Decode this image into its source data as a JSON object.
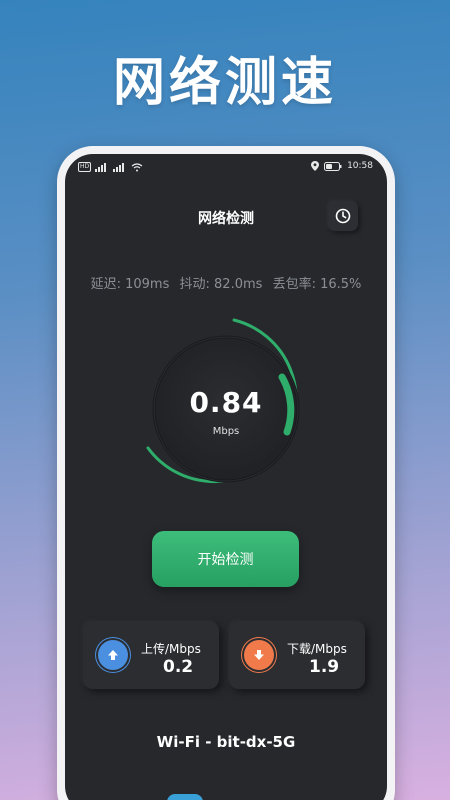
{
  "promo": {
    "title": "网络测速"
  },
  "status_bar": {
    "left_badges": [
      "HD",
      "4G",
      "4G"
    ],
    "time": "10:58",
    "icons": [
      "location-icon",
      "battery-icon",
      "wifi-icon",
      "signal-icon"
    ]
  },
  "header": {
    "title": "网络检测",
    "history_icon": "clock-icon"
  },
  "stats": {
    "latency": "延迟: 109ms",
    "jitter": "抖动: 82.0ms",
    "packet_loss": "丢包率: 16.5%"
  },
  "gauge": {
    "value": "0.84",
    "unit": "Mbps",
    "progress_fraction": 0.05,
    "accent": "#2fae6b"
  },
  "start_button": {
    "label": "开始检测"
  },
  "upload": {
    "label": "上传/Mbps",
    "value": "0.2",
    "icon": "upload-arrow-icon",
    "color": "#4a8fe0"
  },
  "download": {
    "label": "下载/Mbps",
    "value": "1.9",
    "icon": "download-arrow-icon",
    "color": "#f07a4a"
  },
  "network": {
    "name": "Wi-Fi - bit-dx-5G"
  },
  "colors": {
    "background": "#26282c",
    "accent": "#2fae6b"
  }
}
